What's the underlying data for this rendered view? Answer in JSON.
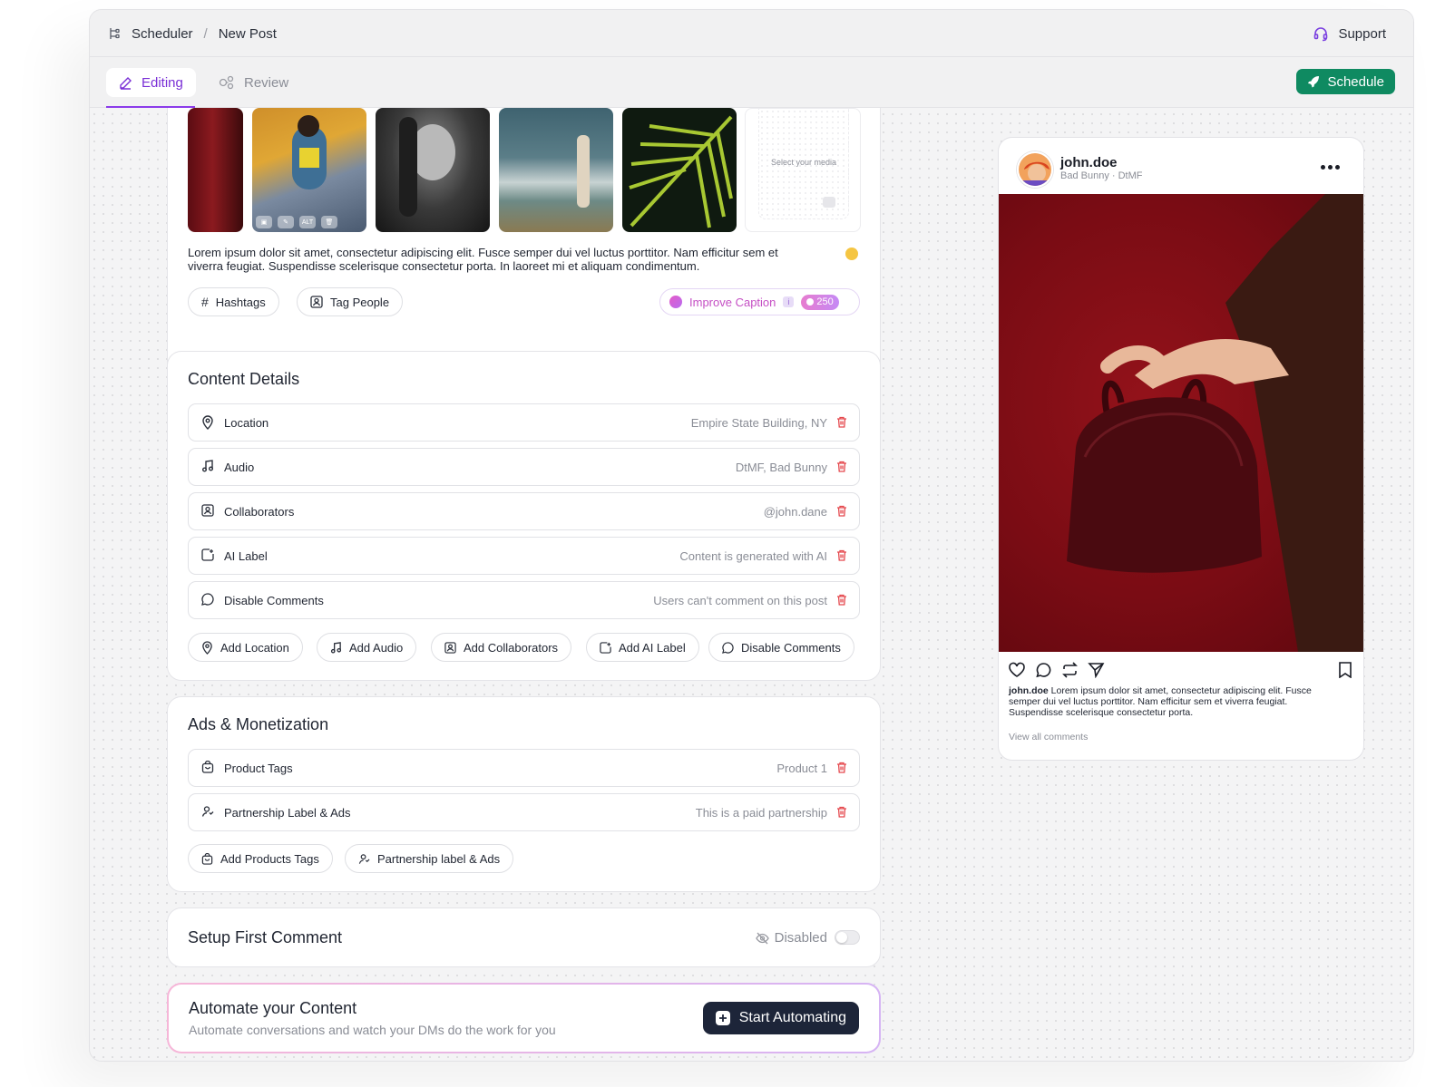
{
  "breadcrumb": {
    "root": "Scheduler",
    "separator": "/",
    "current": "New Post"
  },
  "header": {
    "support_label": "Support"
  },
  "tabs": {
    "editing": "Editing",
    "review": "Review"
  },
  "actions": {
    "schedule_label": "Schedule"
  },
  "media": {
    "select_media_text": "Select your media",
    "thumb_overlay_alt": "ALT",
    "caption": "Lorem ipsum dolor sit amet, consectetur adipiscing elit. Fusce semper dui vel luctus porttitor. Nam efficitur sem et viverra feugiat. Suspendisse scelerisque consectetur porta. In laoreet mi et aliquam condimentum.",
    "hashtags_label": "Hashtags",
    "tag_people_label": "Tag People",
    "improve_caption_label": "Improve Caption",
    "info_badge": "i",
    "credits": "250"
  },
  "content_details": {
    "title": "Content Details",
    "rows": [
      {
        "label": "Location",
        "value": "Empire State Building, NY",
        "icon": "location-icon"
      },
      {
        "label": "Audio",
        "value": "DtMF, Bad Bunny",
        "icon": "music-icon"
      },
      {
        "label": "Collaborators",
        "value": "@john.dane",
        "icon": "collaborators-icon"
      },
      {
        "label": "AI Label",
        "value": "Content is generated with AI",
        "icon": "ai-label-icon"
      },
      {
        "label": "Disable Comments",
        "value": "Users can't comment on this post",
        "icon": "comment-icon"
      }
    ],
    "add_buttons": [
      "Add Location",
      "Add Audio",
      "Add Collaborators",
      "Add AI Label",
      "Disable Comments"
    ]
  },
  "ads": {
    "title": "Ads & Monetization",
    "rows": [
      {
        "label": "Product Tags",
        "value": "Product 1",
        "icon": "shopping-bag-icon"
      },
      {
        "label": "Partnership Label & Ads",
        "value": "This is a paid partnership",
        "icon": "partnership-icon"
      }
    ],
    "add_buttons": [
      "Add Products Tags",
      "Partnership label & Ads"
    ]
  },
  "first_comment": {
    "title": "Setup First Comment",
    "status": "Disabled",
    "enabled": false
  },
  "automate": {
    "title": "Automate your Content",
    "subtitle": "Automate conversations and watch your DMs do the work for you",
    "button_label": "Start Automating"
  },
  "preview": {
    "username": "john.doe",
    "subtitle": "Bad Bunny · DtMF",
    "caption_user": "john.doe",
    "caption": "Lorem ipsum dolor sit amet, consectetur adipiscing elit. Fusce semper dui vel luctus porttitor. Nam efficitur sem et viverra feugiat. Suspendisse scelerisque consectetur porta.",
    "view_comments": "View all comments"
  },
  "colors": {
    "accent": "#8b3bea",
    "schedule_green": "#0f8a61",
    "danger": "#e5484d",
    "dark_button": "#1d2539"
  }
}
